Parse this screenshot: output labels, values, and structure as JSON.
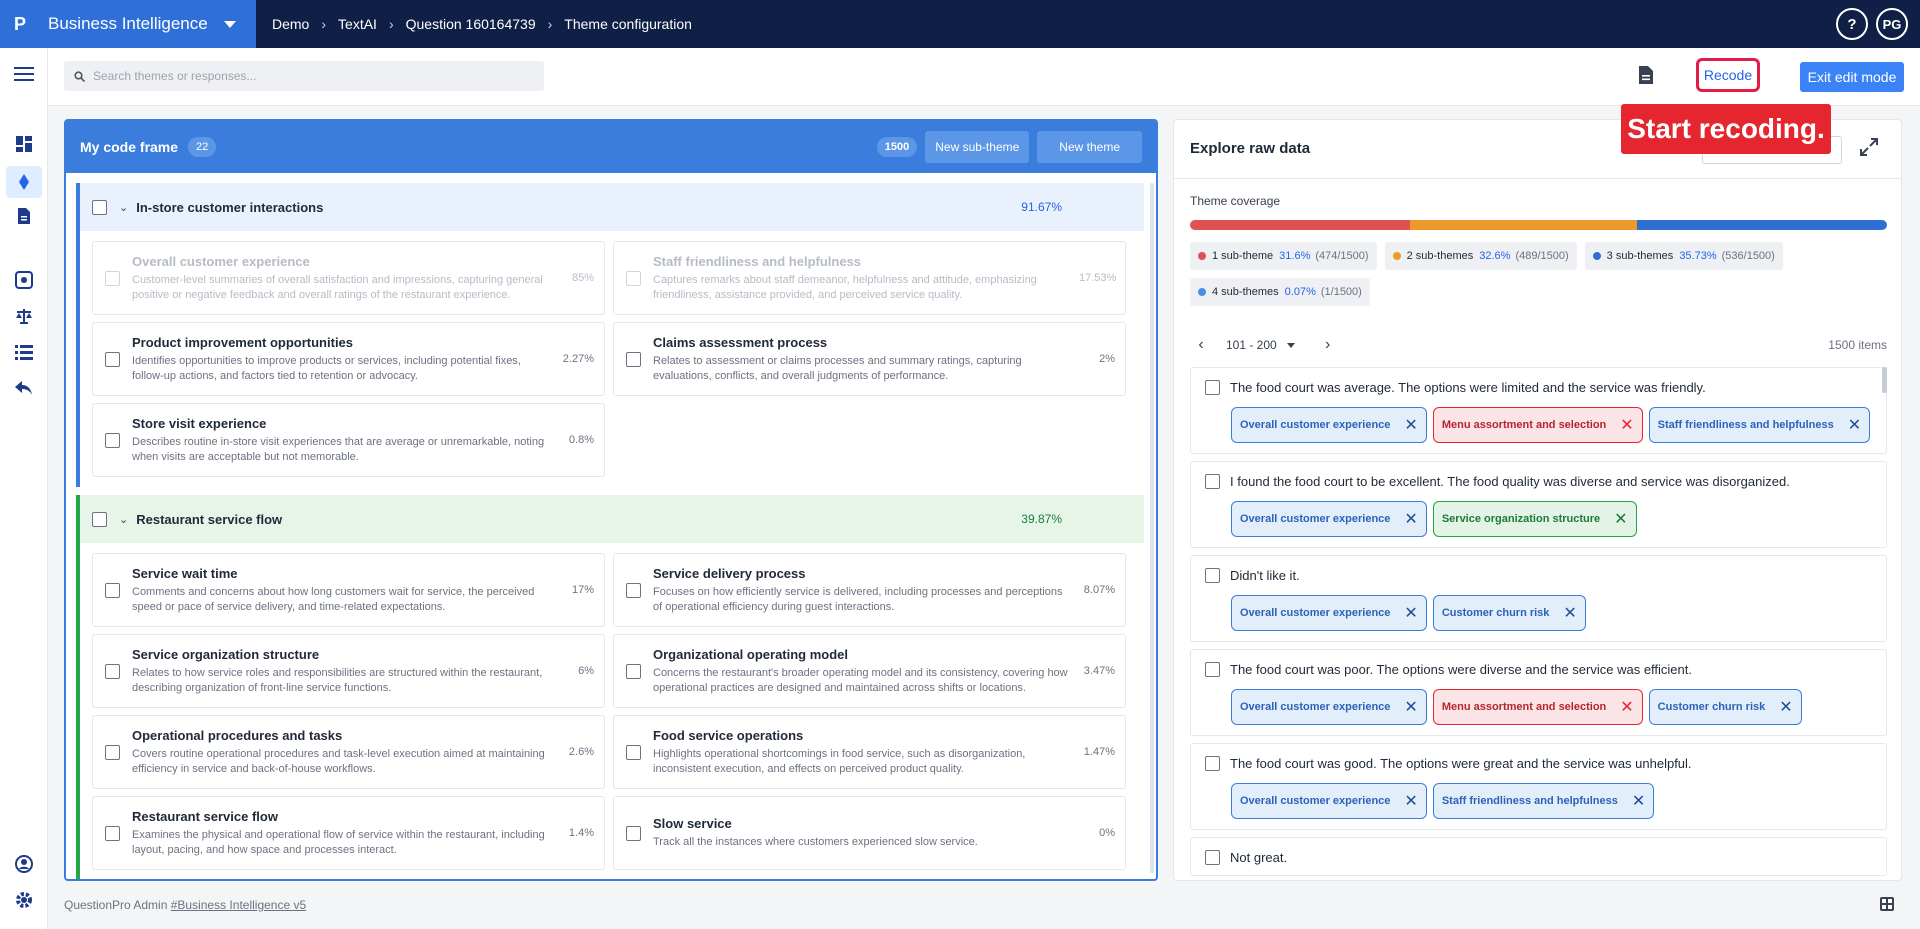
{
  "app": {
    "name": "Business Intelligence"
  },
  "breadcrumb": [
    "Demo",
    "TextAI",
    "Question 160164739",
    "Theme configuration"
  ],
  "header": {
    "help": "?",
    "avatar": "PG"
  },
  "search": {
    "placeholder": "Search themes or responses..."
  },
  "toolbar": {
    "recode_label": "Recode",
    "exit_label": "Exit edit mode"
  },
  "tooltip": "Start recoding.",
  "code_frame": {
    "title": "My code frame",
    "count": "22",
    "total": "1500",
    "new_sub_theme": "New sub-theme",
    "new_theme": "New theme",
    "themes": [
      {
        "title": "In-store customer interactions",
        "pct": "91.67%",
        "subs": [
          {
            "name": "Overall customer experience",
            "desc": "Customer-level summaries of overall satisfaction and impressions, capturing general positive or negative feedback and overall ratings of the restaurant experience.",
            "pct": "85%",
            "disabled": true
          },
          {
            "name": "Staff friendliness and helpfulness",
            "desc": "Captures remarks about staff demeanor, helpfulness and attitude, emphasizing friendliness, assistance provided, and perceived service quality.",
            "pct": "17.53%",
            "disabled": true
          },
          {
            "name": "Product improvement opportunities",
            "desc": "Identifies opportunities to improve products or services, including potential fixes, follow-up actions, and factors tied to retention or advocacy.",
            "pct": "2.27%"
          },
          {
            "name": "Claims assessment process",
            "desc": "Relates to assessment or claims processes and summary ratings, capturing evaluations, conflicts, and overall judgments of performance.",
            "pct": "2%"
          },
          {
            "name": "Store visit experience",
            "desc": "Describes routine in-store visit experiences that are average or unremarkable, noting when visits are acceptable but not memorable.",
            "pct": "0.8%"
          }
        ]
      },
      {
        "title": "Restaurant service flow",
        "pct": "39.87%",
        "subs": [
          {
            "name": "Service wait time",
            "desc": "Comments and concerns about how long customers wait for service, the perceived speed or pace of service delivery, and time-related expectations.",
            "pct": "17%"
          },
          {
            "name": "Service delivery process",
            "desc": "Focuses on how efficiently service is delivered, including processes and perceptions of operational efficiency during guest interactions.",
            "pct": "8.07%"
          },
          {
            "name": "Service organization structure",
            "desc": "Relates to how service roles and responsibilities are structured within the restaurant, describing organization of front-line service functions.",
            "pct": "6%"
          },
          {
            "name": "Organizational operating model",
            "desc": "Concerns the restaurant's broader operating model and its consistency, covering how operational practices are designed and maintained across shifts or locations.",
            "pct": "3.47%"
          },
          {
            "name": "Operational procedures and tasks",
            "desc": "Covers routine operational procedures and task-level execution aimed at maintaining efficiency in service and back-of-house workflows.",
            "pct": "2.6%"
          },
          {
            "name": "Food service operations",
            "desc": "Highlights operational shortcomings in food service, such as disorganization, inconsistent execution, and effects on perceived product quality.",
            "pct": "1.47%"
          },
          {
            "name": "Restaurant service flow",
            "desc": "Examines the physical and operational flow of service within the restaurant, including layout, pacing, and how space and processes interact.",
            "pct": "1.4%"
          },
          {
            "name": "Slow service",
            "desc": "Track all the instances where customers experienced slow service.",
            "pct": "0%"
          }
        ]
      }
    ]
  },
  "explore": {
    "title": "Explore raw data",
    "coverage_label": "Theme coverage",
    "coverage": [
      {
        "label": "1 sub-theme",
        "pct": "31.6%",
        "count": "(474/1500)",
        "value": 0.316,
        "color": "#e05252"
      },
      {
        "label": "2 sub-themes",
        "pct": "32.6%",
        "count": "(489/1500)",
        "value": 0.326,
        "color": "#ec9a2e"
      },
      {
        "label": "3 sub-themes",
        "pct": "35.73%",
        "count": "(536/1500)",
        "value": 0.3573,
        "color": "#2f6fd1"
      },
      {
        "label": "4 sub-themes",
        "pct": "0.07%",
        "count": "(1/1500)",
        "value": 0.0007,
        "color": "#4a90e2"
      }
    ],
    "pager": {
      "range": "101 - 200",
      "items": "1500 items"
    },
    "responses": [
      {
        "text": "The food court was average. The options were limited and the service was friendly.",
        "tags": [
          {
            "label": "Overall customer experience",
            "color": "blue"
          },
          {
            "label": "Menu assortment and selection",
            "color": "red"
          },
          {
            "label": "Staff friendliness and helpfulness",
            "color": "blue"
          }
        ]
      },
      {
        "text": "I found the food court to be excellent. The food quality was diverse and service was disorganized.",
        "tags": [
          {
            "label": "Overall customer experience",
            "color": "blue"
          },
          {
            "label": "Service organization structure",
            "color": "green"
          }
        ]
      },
      {
        "text": "Didn't like it.",
        "tags": [
          {
            "label": "Overall customer experience",
            "color": "blue"
          },
          {
            "label": "Customer churn risk",
            "color": "blue"
          }
        ]
      },
      {
        "text": "The food court was poor. The options were diverse and the service was efficient.",
        "tags": [
          {
            "label": "Overall customer experience",
            "color": "blue"
          },
          {
            "label": "Menu assortment and selection",
            "color": "red"
          },
          {
            "label": "Customer churn risk",
            "color": "blue"
          }
        ]
      },
      {
        "text": "The food court was good. The options were great and the service was unhelpful.",
        "tags": [
          {
            "label": "Overall customer experience",
            "color": "blue"
          },
          {
            "label": "Staff friendliness and helpfulness",
            "color": "blue"
          }
        ]
      },
      {
        "text": "Not great.",
        "tags": []
      }
    ]
  },
  "footer": {
    "text": "QuestionPro Admin",
    "link": "#Business Intelligence v5"
  }
}
